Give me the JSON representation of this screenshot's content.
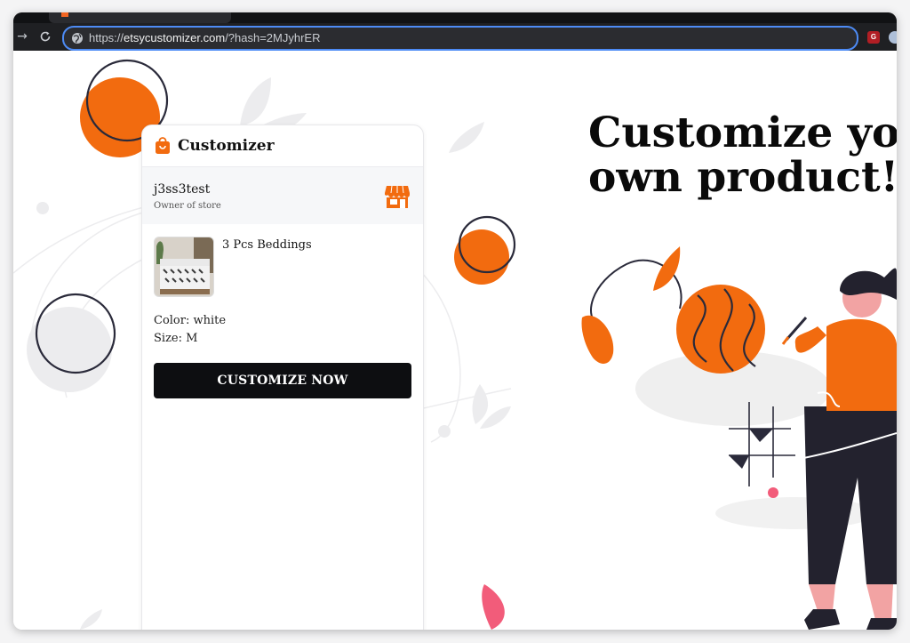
{
  "browser": {
    "url_prefix": "https://",
    "url_domain": "etsycustomizer.com",
    "url_path": "/?hash=2MJyhrER",
    "extension_badge": "G",
    "nav": {
      "back": "→",
      "reload": "C"
    }
  },
  "panel": {
    "title": "Customizer",
    "store": {
      "name": "j3ss3test",
      "role": "Owner of store"
    },
    "product": {
      "name": "3 Pcs Beddings",
      "color_label": "Color: white",
      "size_label": "Size: M"
    },
    "cta_label": "CUSTOMIZE NOW"
  },
  "hero": {
    "line1": "Customize yo",
    "line2": "own product!"
  },
  "colors": {
    "accent": "#f26b0f",
    "cta_bg": "#0d0e11",
    "address_focus": "#4d8bf5",
    "leaf_pink": "#f25c7a"
  },
  "icons": {
    "bag": "shopping-bag-icon",
    "store": "storefront-icon",
    "globe": "globe-icon"
  }
}
